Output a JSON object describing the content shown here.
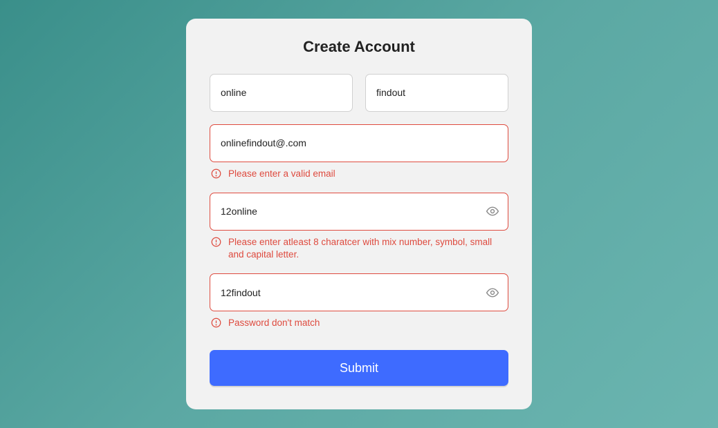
{
  "form": {
    "title": "Create Account",
    "firstName": {
      "value": "online"
    },
    "lastName": {
      "value": "findout"
    },
    "email": {
      "value": "onlinefindout@.com",
      "error": "Please enter a valid email"
    },
    "password": {
      "value": "12online",
      "error": "Please enter atleast 8 charatcer with mix number, symbol, small and capital letter."
    },
    "confirmPassword": {
      "value": "12findout",
      "error": "Password don't match"
    },
    "submitLabel": "Submit"
  },
  "colors": {
    "error": "#de4a3e",
    "accent": "#3e6bff"
  }
}
